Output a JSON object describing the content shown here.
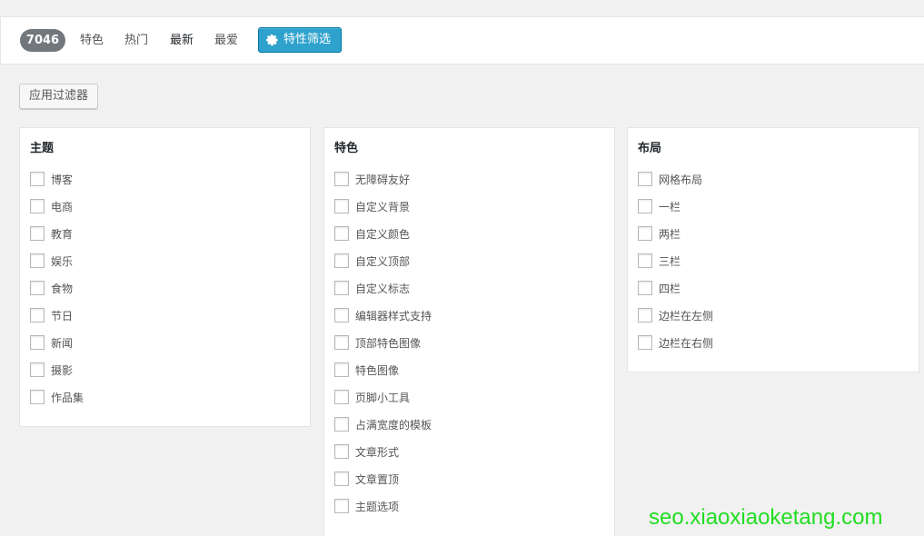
{
  "filter_bar": {
    "count": "7046",
    "links": [
      "特色",
      "热门",
      "最新",
      "最爱"
    ],
    "feature_filter_label": "特性筛选"
  },
  "apply_filter_label": "应用过滤器",
  "panels": [
    {
      "title": "主题",
      "options": [
        "博客",
        "电商",
        "教育",
        "娱乐",
        "食物",
        "节日",
        "新闻",
        "摄影",
        "作品集"
      ]
    },
    {
      "title": "特色",
      "options": [
        "无障碍友好",
        "自定义背景",
        "自定义颜色",
        "自定义顶部",
        "自定义标志",
        "编辑器样式支持",
        "顶部特色图像",
        "特色图像",
        "页脚小工具",
        "占满宽度的模板",
        "文章形式",
        "文章置顶",
        "主题选项"
      ]
    },
    {
      "title": "布局",
      "options": [
        "网格布局",
        "一栏",
        "两栏",
        "三栏",
        "四栏",
        "边栏在左侧",
        "边栏在右侧"
      ]
    }
  ],
  "watermark": "seo.xiaoxiaoketang.com",
  "colors": {
    "accent": "#2ea2cc",
    "badge": "#72777c",
    "watermark": "#22dd22"
  }
}
